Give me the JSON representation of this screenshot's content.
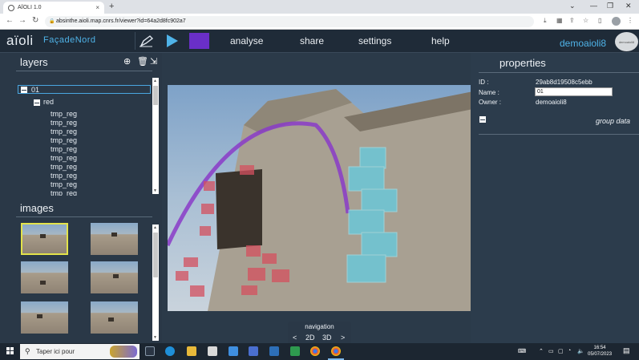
{
  "browser": {
    "tab_title": "AÏOLI 1.0",
    "tab_close": "×",
    "new_tab": "+",
    "url": "absinthe.aioli.map.cnrs.fr/viewer?id=64a2d8fc902a7",
    "window_controls": [
      "⌄",
      "—",
      "❐",
      "✕"
    ]
  },
  "app": {
    "logo": "aïoli",
    "project_name": "FaçadeNord",
    "menu": [
      "analyse",
      "share",
      "settings",
      "help"
    ],
    "user_name": "demoaioli8",
    "avatar_label": "demoaioli8",
    "accent_color": "#4fb3e8",
    "tool_color": "#6a2fc8"
  },
  "layers": {
    "title": "layers",
    "top_group": "01",
    "sub_group": "red",
    "items": [
      "tmp_reg",
      "tmp_reg",
      "tmp_reg",
      "tmp_reg",
      "tmp_reg",
      "tmp_reg",
      "tmp_reg",
      "tmp_reg",
      "tmp_reg",
      "tmp_reg"
    ]
  },
  "images": {
    "title": "images"
  },
  "navigation": {
    "title": "navigation",
    "prev": "<",
    "mode_2d": "2D",
    "mode_3d": "3D",
    "next": ">"
  },
  "properties": {
    "title": "properties",
    "id_label": "ID :",
    "id_value": "29ab8d19508c5ebb",
    "name_label": "Name :",
    "name_value": "01",
    "owner_label": "Owner :",
    "owner_value": "demoaioli8",
    "group_data": "group data"
  },
  "taskbar": {
    "search_placeholder": "Taper ici pour",
    "time": "16:54",
    "date": "05/07/2023"
  }
}
